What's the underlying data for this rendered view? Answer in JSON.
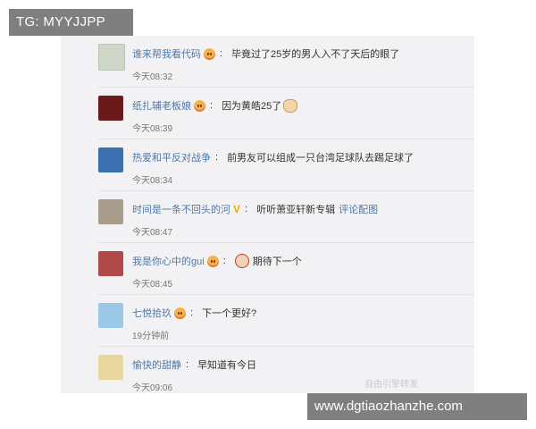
{
  "overlay_top_left": "TG: MYYJJPP",
  "overlay_bottom_right": "www.dgtiaozhanzhe.com",
  "watermark": "自由引擎转发",
  "comments": [
    {
      "username": "谁来帮我看代码",
      "text": "毕竟过了25岁的男人入不了天后的眼了",
      "time": "今天08:32",
      "avatar_color": "#cfd8c8"
    },
    {
      "username": "纸扎辅老板娘",
      "text": "因为黄皓25了",
      "time": "今天08:39",
      "avatar_color": "#6b1a1a"
    },
    {
      "username": "热爱和平反对战争",
      "text": "前男友可以组成一只台湾足球队去踢足球了",
      "time": "今天08:34",
      "avatar_color": "#3a6fb0"
    },
    {
      "username": "时间是一条不回头的河",
      "text": "听听萧亚轩新专辑",
      "link": "评论配图",
      "time": "今天08:47",
      "avatar_color": "#a89c8c"
    },
    {
      "username": "我是你心中的gui",
      "text": "期待下一个",
      "time": "今天08:45",
      "avatar_color": "#b04a4a"
    },
    {
      "username": "七悦拾玖",
      "text": "下一个更好?",
      "time": "19分钟前",
      "avatar_color": "#9cc8e8"
    },
    {
      "username": "愉快的甜静",
      "text": "早知道有今日",
      "time": "今天09:06",
      "avatar_color": "#e8d8a0"
    }
  ],
  "icons": {
    "badge": "emoji-badge-icon",
    "vip": "v-verified-icon"
  }
}
